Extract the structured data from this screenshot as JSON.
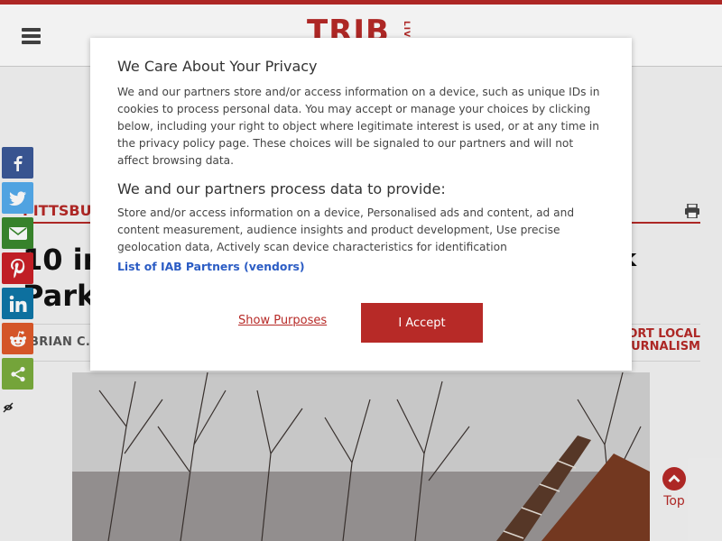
{
  "header": {
    "logo": "TRIB",
    "logo_suffix": "LIVE"
  },
  "article": {
    "section": "PITTSBURGH",
    "headline_left": "10 inj",
    "headline_line2": "Park",
    "headline_right": "k",
    "byline": "BRIAN C. RI",
    "support_line1": "PORT LOCAL",
    "support_line2": "URNALISM"
  },
  "share_buttons": [
    {
      "name": "facebook",
      "color": "#3b5998"
    },
    {
      "name": "twitter",
      "color": "#55acee"
    },
    {
      "name": "email",
      "color": "#3a8a2e"
    },
    {
      "name": "pinterest",
      "color": "#cb2027"
    },
    {
      "name": "linkedin",
      "color": "#0e76a8"
    },
    {
      "name": "reddit",
      "color": "#e05a2b"
    },
    {
      "name": "more",
      "color": "#7bad3e"
    }
  ],
  "top_button": {
    "label": "Top"
  },
  "consent": {
    "title": "We Care About Your Privacy",
    "body": "We and our partners store and/or access information on a device, such as unique IDs in cookies to process personal data. You may accept or manage your choices by clicking below, including your right to object where legitimate interest is used, or at any time in the privacy policy page. These choices will be signaled to our partners and will not affect browsing data.",
    "subtitle": "We and our partners process data to provide:",
    "purposes": "Store and/or access information on a device, Personalised ads and content, ad and content measurement, audience insights and product development, Use precise geolocation data, Actively scan device characteristics for identification",
    "vendors_link": "List of IAB Partners (vendors)",
    "show_purposes": "Show Purposes",
    "accept": "I Accept"
  },
  "colors": {
    "brand": "#b72a27",
    "link": "#2b5cc4"
  }
}
